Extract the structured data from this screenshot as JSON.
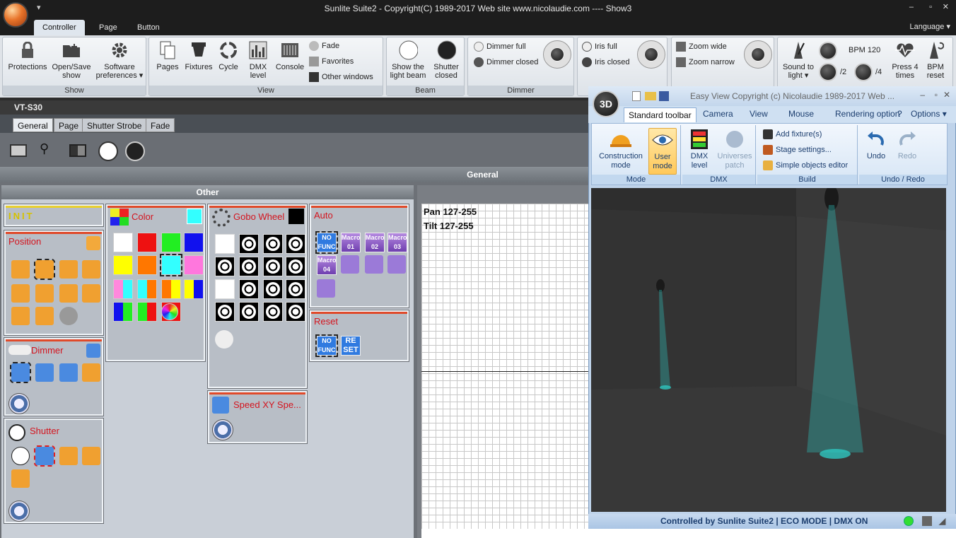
{
  "window": {
    "title": "Sunlite Suite2 - Copyright(C) 1989-2017    Web site www.nicolaudie.com ---- Show3"
  },
  "menu_tabs": [
    "Controller",
    "Page",
    "Button"
  ],
  "language_label": "Language",
  "ribbon": {
    "show": {
      "caption": "Show",
      "protections": "Protections",
      "open_save": "Open/Save show",
      "software_prefs": "Software preferences"
    },
    "view": {
      "caption": "View",
      "pages": "Pages",
      "fixtures": "Fixtures",
      "cycle": "Cycle",
      "dmx_level": "DMX level",
      "console": "Console",
      "fade": "Fade",
      "favorites": "Favorites",
      "other_windows": "Other windows"
    },
    "beam": {
      "caption": "Beam",
      "show_light_beam": "Show the light beam",
      "shutter_closed": "Shutter closed"
    },
    "dimmer": {
      "caption": "Dimmer",
      "full": "Dimmer full",
      "closed": "Dimmer closed"
    },
    "iris": {
      "full": "Iris full",
      "closed": "Iris closed"
    },
    "zoom": {
      "wide": "Zoom wide",
      "narrow": "Zoom narrow"
    },
    "bpm": {
      "sound_to_light": "Sound to light",
      "bpm_value": "BPM 120",
      "div2": "/2",
      "div4": "/4",
      "press4": "Press 4 times",
      "bpm_reset": "BPM reset"
    }
  },
  "fixture": {
    "name": "VT-S30"
  },
  "sub_tabs": [
    "General",
    "Page",
    "Shutter Strobe",
    "Fade"
  ],
  "general_label": "General",
  "other_label": "Other",
  "boxes": {
    "init": "INIT",
    "position": "Position",
    "dimmer": "Dimmer",
    "shutter": "Shutter",
    "color": "Color",
    "gobo": "Gobo Wheel",
    "speed": "Speed XY Spe...",
    "auto": "Auto",
    "reset": "Reset"
  },
  "auto_items": {
    "nofunc": "NO FUNC",
    "macros": [
      "Macro 01",
      "Macro 02",
      "Macro 03",
      "Macro 04"
    ],
    "reset_btn": "RE SET"
  },
  "colors": {
    "swatches": [
      "#ffffff",
      "#ee1111",
      "#22ee22",
      "#1111ee",
      "#ffff00",
      "#ff7700",
      "#33ffff",
      "#ff77dd"
    ],
    "selected": "#33ffff",
    "row3": [
      [
        "#ff88dd",
        "#33ffff"
      ],
      [
        "#33ffff",
        "#ff7700"
      ],
      [
        "#ff7700",
        "#ffff00"
      ],
      [
        "#ffff00",
        "#1111ee"
      ]
    ],
    "row4": [
      [
        "#1111ee",
        "#22ee22"
      ],
      [
        "#22ee22",
        "#ee1111"
      ],
      [
        "#ee1111",
        "#ee1111"
      ]
    ]
  },
  "grid": {
    "pan": "Pan 127-255",
    "tilt": "Tilt 127-255"
  },
  "easyview": {
    "title": "Easy View   Copyright (c) Nicolaudie 1989-2017   Web ...",
    "badge": "3D",
    "tabs": [
      "Standard toolbar",
      "Camera",
      "View",
      "Mouse",
      "Rendering option",
      "?",
      "Options"
    ],
    "mode": {
      "caption": "Mode",
      "construction": "Construction mode",
      "user": "User mode"
    },
    "dmx": {
      "caption": "DMX",
      "dmx_level": "DMX level",
      "universes": "Universes patch"
    },
    "build": {
      "caption": "Build",
      "add_fixture": "Add fixture(s)",
      "stage": "Stage settings...",
      "simple": "Simple objects editor"
    },
    "undo": {
      "caption": "Undo / Redo",
      "undo": "Undo",
      "redo": "Redo"
    },
    "status": "Controlled by Sunlite Suite2  |  ECO MODE  |  DMX ON"
  },
  "accent": {
    "red_title": "#d4141e",
    "orange": "#e8742a",
    "beam": "#2ec7c0"
  }
}
